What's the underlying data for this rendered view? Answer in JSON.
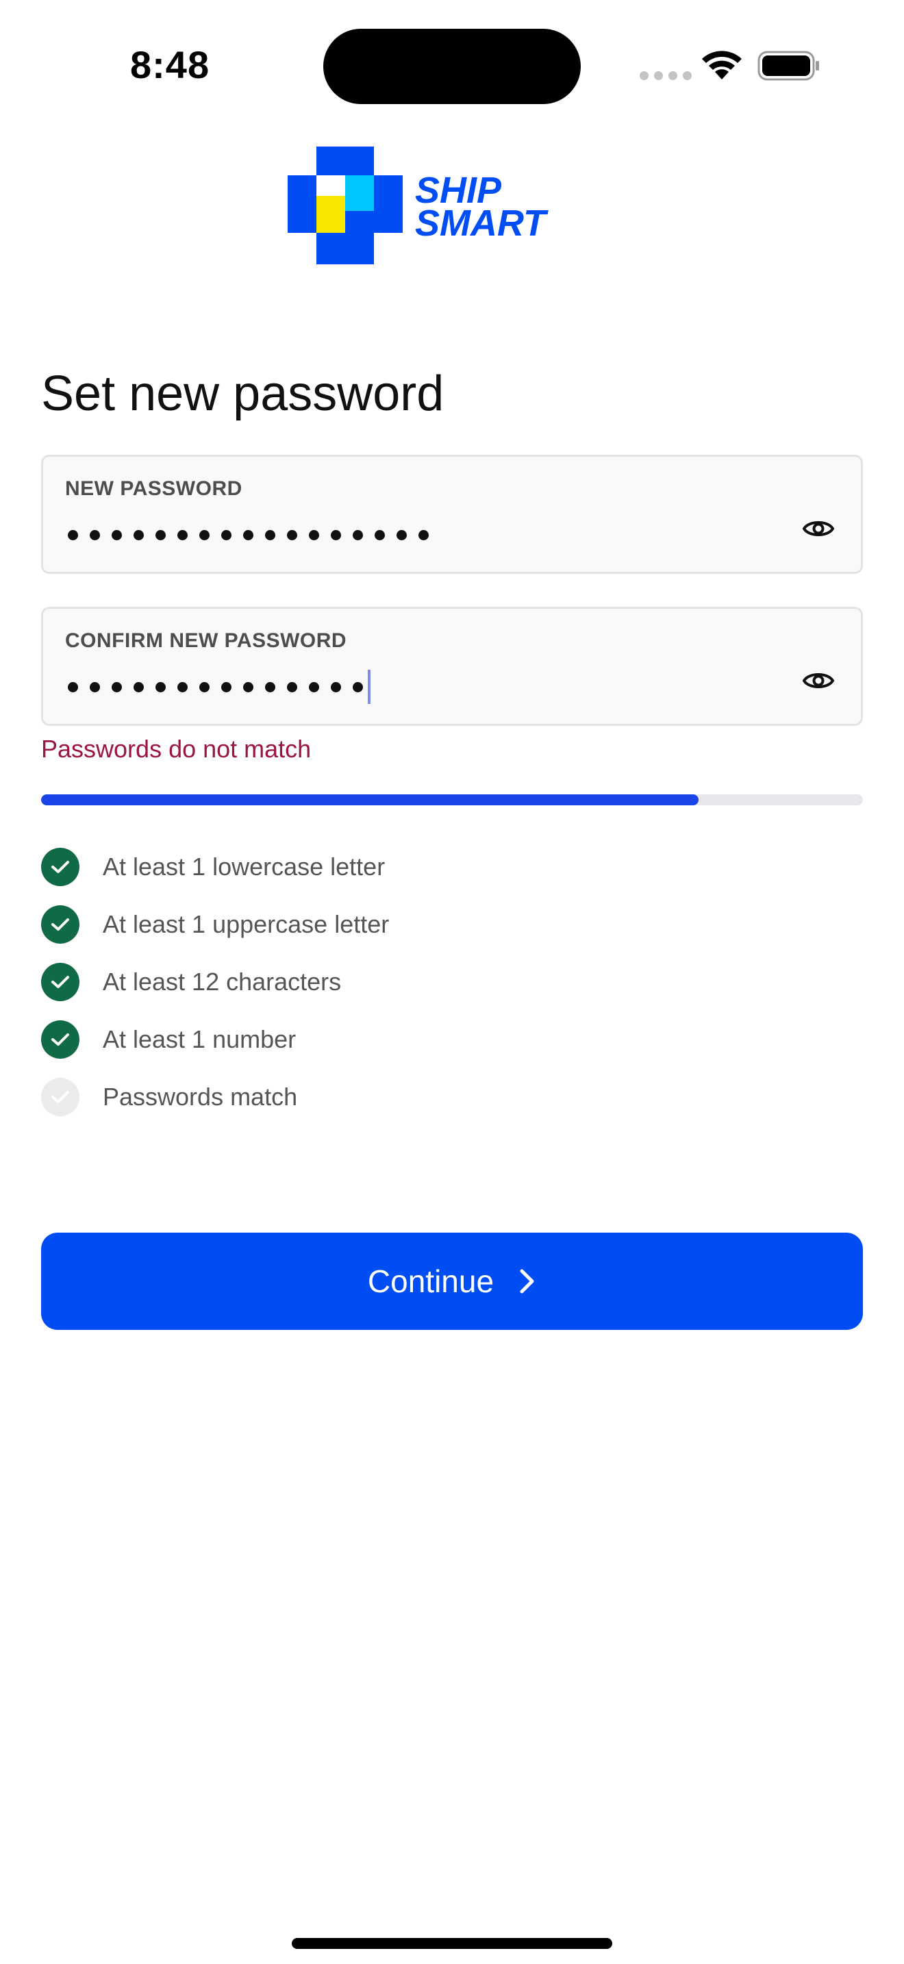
{
  "status_bar": {
    "time": "8:48"
  },
  "logo": {
    "line1": "SHIP",
    "line2": "SMART",
    "colors": {
      "blue": "#004ef3",
      "cyan": "#00c8ff",
      "yellow": "#f7e600"
    }
  },
  "page": {
    "title": "Set new password"
  },
  "new_password": {
    "label": "NEW PASSWORD",
    "masked_length": 17,
    "toggle_icon": "eye-icon"
  },
  "confirm_password": {
    "label": "CONFIRM NEW PASSWORD",
    "masked_length": 14,
    "toggle_icon": "eye-icon"
  },
  "error": {
    "message": "Passwords do not match",
    "color": "#9a1541"
  },
  "strength": {
    "fraction": 0.8,
    "fill_color": "#1a43e8"
  },
  "requirements": [
    {
      "label": "At least 1 lowercase letter",
      "met": true
    },
    {
      "label": "At least 1 uppercase letter",
      "met": true
    },
    {
      "label": "At least 12 characters",
      "met": true
    },
    {
      "label": "At least 1 number",
      "met": true
    },
    {
      "label": "Passwords match",
      "met": false
    }
  ],
  "continue_button": {
    "label": "Continue",
    "icon": "chevron-right-icon",
    "color": "#004ef3"
  }
}
